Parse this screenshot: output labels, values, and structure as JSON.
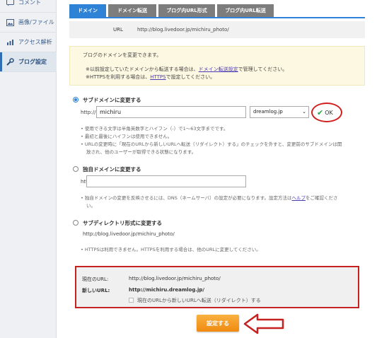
{
  "sidebar": {
    "items": [
      {
        "label": "コメント",
        "icon": "comment-icon"
      },
      {
        "label": "画像/ファイル",
        "icon": "image-icon"
      },
      {
        "label": "アクセス解析",
        "icon": "chart-icon"
      },
      {
        "label": "ブログ設定",
        "icon": "wrench-icon",
        "active": true
      }
    ]
  },
  "tabs": [
    "ドメイン",
    "ドメイン転送",
    "ブログ内URL形式",
    "ブログ内URL転送"
  ],
  "url_row": {
    "label": "URL",
    "value": "http://blog.livedoor.jp/michiru_photo/"
  },
  "notice": {
    "line1": "ブログのドメインを変更できます。",
    "line2_pre": "※以前設定していたドメインから転送する場合は、",
    "line2_link": "ドメイン転送設定",
    "line2_post": "で管理してください。",
    "line3_pre": "※HTTPSを利用する場合は、",
    "line3_link": "HTTPS",
    "line3_post": "で設定してください。"
  },
  "subdomain": {
    "title": "サブドメインに変更する",
    "prefix": "http://",
    "value": "michiru",
    "domain": "dreamlog.jp",
    "ok_label": "OK",
    "notes": [
      "使用できる文字は半角英数字とハイフン（-）で1〜63文字までです。",
      "最初と最後にハイフンは使用できません。",
      "URLの変更時に「現在のURLから新しいURLへ転送（リダイレクト）する」のチェックを外すと、変更前のサブドメインは開",
      "放され、他のユーザーが取得できる状態になります。"
    ]
  },
  "custom_domain": {
    "title": "独自ドメインに変更する",
    "prefix": "http://",
    "value": "",
    "note_pre": "独自ドメインの変更を反映させるには、DNS（ネームサーバ）の設定が必要になります。設定方法は",
    "note_link": "ヘルプ",
    "note_post": "をご確認くださ",
    "note_line2": "い。"
  },
  "subdirectory": {
    "title": "サブディレクトリ形式に変更する",
    "url": "http://blog.livedoor.jp/michiru_photo/",
    "note": "HTTPSは利用できません。HTTPSを利用する場合は、他のURLに変更してください。"
  },
  "summary": {
    "current_label": "現在のURL:",
    "current_value": "http://blog.livedoor.jp/michiru_photo/",
    "new_label": "新しいURL:",
    "new_value": "http://michiru.dreamlog.jp/",
    "redirect_label": "現在のURLから新しいURLへ転送（リダイレクト）する"
  },
  "submit_label": "設定する",
  "colors": {
    "accent": "#2f83d6",
    "annotation": "#c62121",
    "button": "#f08a10"
  }
}
